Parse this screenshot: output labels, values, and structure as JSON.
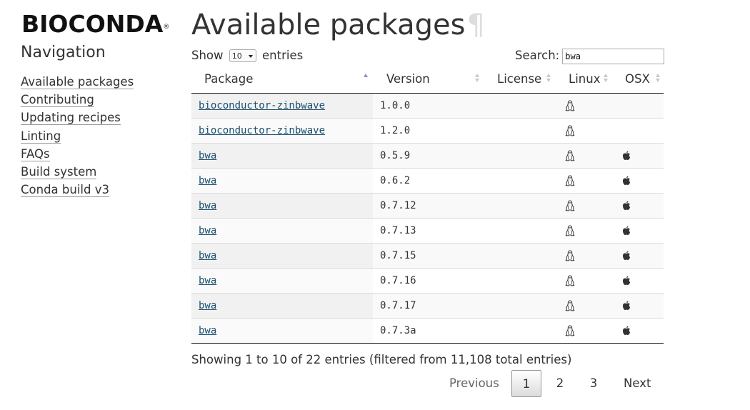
{
  "brand": {
    "logo_text": "BIOCONDA",
    "logo_mark": "®"
  },
  "sidebar": {
    "heading": "Navigation",
    "items": [
      {
        "label": "Available packages"
      },
      {
        "label": "Contributing"
      },
      {
        "label": "Updating recipes"
      },
      {
        "label": "Linting"
      },
      {
        "label": "FAQs"
      },
      {
        "label": "Build system"
      },
      {
        "label": "Conda build v3"
      }
    ]
  },
  "main": {
    "title": "Available packages",
    "title_anchor": "¶",
    "length_control": {
      "prefix": "Show",
      "value": "10",
      "suffix": "entries"
    },
    "search": {
      "label": "Search:",
      "value": "bwa"
    },
    "table": {
      "columns": [
        {
          "label": "Package"
        },
        {
          "label": "Version"
        },
        {
          "label": "License"
        },
        {
          "label": "Linux"
        },
        {
          "label": "OSX"
        }
      ],
      "rows": [
        {
          "package": "bioconductor-zinbwave",
          "version": "1.0.0",
          "license": "",
          "linux": "linux-icon",
          "osx": ""
        },
        {
          "package": "bioconductor-zinbwave",
          "version": "1.2.0",
          "license": "",
          "linux": "linux-icon",
          "osx": ""
        },
        {
          "package": "bwa",
          "version": "0.5.9",
          "license": "",
          "linux": "linux-icon",
          "osx": "apple-icon"
        },
        {
          "package": "bwa",
          "version": "0.6.2",
          "license": "",
          "linux": "linux-icon",
          "osx": "apple-icon"
        },
        {
          "package": "bwa",
          "version": "0.7.12",
          "license": "",
          "linux": "linux-icon",
          "osx": "apple-icon"
        },
        {
          "package": "bwa",
          "version": "0.7.13",
          "license": "",
          "linux": "linux-icon",
          "osx": "apple-icon"
        },
        {
          "package": "bwa",
          "version": "0.7.15",
          "license": "",
          "linux": "linux-icon",
          "osx": "apple-icon"
        },
        {
          "package": "bwa",
          "version": "0.7.16",
          "license": "",
          "linux": "linux-icon",
          "osx": "apple-icon"
        },
        {
          "package": "bwa",
          "version": "0.7.17",
          "license": "",
          "linux": "linux-icon",
          "osx": "apple-icon"
        },
        {
          "package": "bwa",
          "version": "0.7.3a",
          "license": "",
          "linux": "linux-icon",
          "osx": "apple-icon"
        }
      ]
    },
    "info": "Showing 1 to 10 of 22 entries (filtered from 11,108 total entries)",
    "pagination": {
      "previous": "Previous",
      "pages": [
        "1",
        "2",
        "3"
      ],
      "current": "1",
      "next": "Next"
    }
  },
  "colors": {
    "link": "#1a4f6e",
    "text": "#333333",
    "sort_active": "#8a8ad6"
  }
}
